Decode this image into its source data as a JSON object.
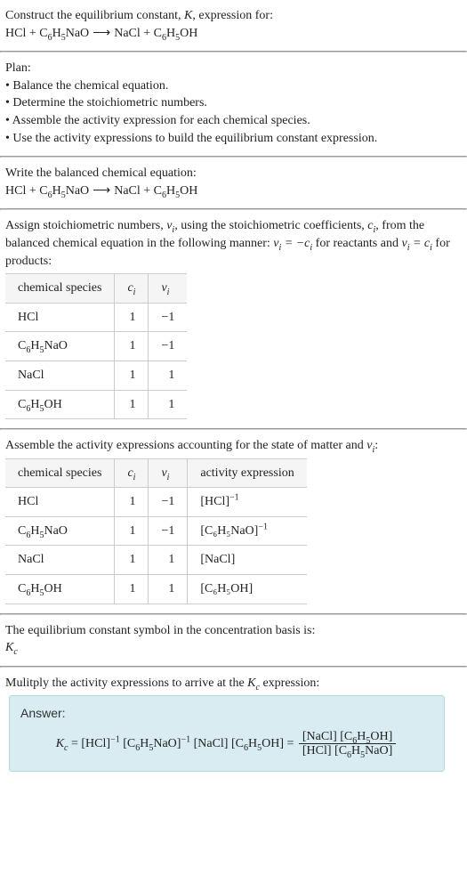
{
  "intro": {
    "line1": "Construct the equilibrium constant, ",
    "k": "K",
    "line1b": ", expression for:"
  },
  "equation_plain": "HCl + C₆H₅NaO ⟶ NaCl + C₆H₅OH",
  "plan_label": "Plan:",
  "plan": [
    "Balance the chemical equation.",
    "Determine the stoichiometric numbers.",
    "Assemble the activity expression for each chemical species.",
    "Use the activity expressions to build the equilibrium constant expression."
  ],
  "balanced_label": "Write the balanced chemical equation:",
  "stoich_text": {
    "a": "Assign stoichiometric numbers, ",
    "nu": "ν",
    "sub_i": "i",
    "b": ", using the stoichiometric coefficients, ",
    "c": "c",
    "d": ", from the balanced chemical equation in the following manner: ",
    "eq1": "νᵢ = −cᵢ",
    "e": " for reactants and ",
    "eq2": "νᵢ = cᵢ",
    "f": " for products:"
  },
  "table1": {
    "headers": {
      "species": "chemical species",
      "ci": "c",
      "nui": "ν"
    },
    "rows": [
      {
        "species": "HCl",
        "ci": "1",
        "nui": "−1"
      },
      {
        "species": "C₆H₅NaO",
        "ci": "1",
        "nui": "−1"
      },
      {
        "species": "NaCl",
        "ci": "1",
        "nui": "1"
      },
      {
        "species": "C₆H₅OH",
        "ci": "1",
        "nui": "1"
      }
    ]
  },
  "activity_label_a": "Assemble the activity expressions accounting for the state of matter and ",
  "activity_label_b": ":",
  "table2": {
    "headers": {
      "species": "chemical species",
      "ci": "c",
      "nui": "ν",
      "act": "activity expression"
    },
    "rows": [
      {
        "species": "HCl",
        "ci": "1",
        "nui": "−1",
        "act_base": "[HCl]",
        "act_exp": "−1"
      },
      {
        "species": "C₆H₅NaO",
        "ci": "1",
        "nui": "−1",
        "act_base": "[C₆H₅NaO]",
        "act_exp": "−1"
      },
      {
        "species": "NaCl",
        "ci": "1",
        "nui": "1",
        "act_base": "[NaCl]",
        "act_exp": ""
      },
      {
        "species": "C₆H₅OH",
        "ci": "1",
        "nui": "1",
        "act_base": "[C₆H₅OH]",
        "act_exp": ""
      }
    ]
  },
  "kc_intro": "The equilibrium constant symbol in the concentration basis is:",
  "kc_symbol": "K",
  "kc_sub": "c",
  "multiply_a": "Mulitply the activity expressions to arrive at the ",
  "multiply_b": " expression:",
  "answer": {
    "label": "Answer:",
    "lhs": "Kc",
    "left": "[HCl]⁻¹ [C₆H₅NaO]⁻¹ [NaCl] [C₆H₅OH]",
    "frac_num": "[NaCl] [C₆H₅OH]",
    "frac_den": "[HCl] [C₆H₅NaO]"
  }
}
